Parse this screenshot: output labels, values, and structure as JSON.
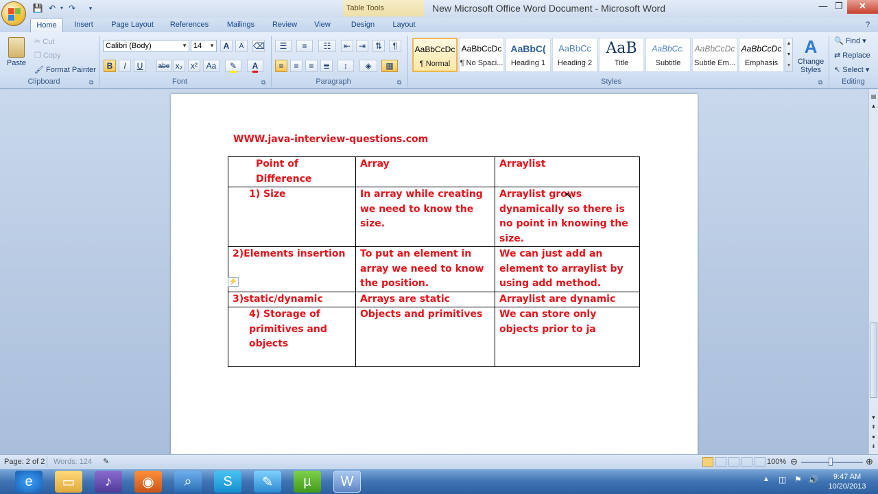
{
  "window": {
    "title": "New Microsoft Office Word Document - Microsoft Word",
    "context_tab_group": "Table Tools"
  },
  "quick_access": {
    "save": "save-icon",
    "undo": "undo-icon",
    "redo": "redo-icon",
    "customize": "▾"
  },
  "tabs": [
    "Home",
    "Insert",
    "Page Layout",
    "References",
    "Mailings",
    "Review",
    "View",
    "Design",
    "Layout"
  ],
  "clipboard": {
    "paste": "Paste",
    "cut": "Cut",
    "copy": "Copy",
    "format_painter": "Format Painter",
    "label": "Clipboard"
  },
  "font": {
    "name": "Calibri (Body)",
    "size": "14",
    "label": "Font",
    "bold": "B",
    "italic": "I",
    "underline": "U",
    "strike": "abe",
    "subscript": "x₂",
    "superscript": "x²",
    "change_case": "Aa",
    "grow": "A",
    "shrink": "A"
  },
  "paragraph": {
    "label": "Paragraph",
    "show_marks": "¶"
  },
  "styles": {
    "label": "Styles",
    "items": [
      {
        "preview": "AaBbCcDc",
        "name": "¶ Normal"
      },
      {
        "preview": "AaBbCcDc",
        "name": "¶ No Spaci..."
      },
      {
        "preview": "AaBbC(",
        "name": "Heading 1"
      },
      {
        "preview": "AaBbCc",
        "name": "Heading 2"
      },
      {
        "preview": "AaB",
        "name": "Title"
      },
      {
        "preview": "AaBbCc.",
        "name": "Subtitle"
      },
      {
        "preview": "AaBbCcDc",
        "name": "Subtle Em..."
      },
      {
        "preview": "AaBbCcDc",
        "name": "Emphasis"
      }
    ],
    "change_styles": "Change Styles"
  },
  "editing": {
    "label": "Editing",
    "find": "Find",
    "replace": "Replace",
    "select": "Select"
  },
  "document": {
    "url": "WWW.java-interview-questions.com",
    "table": {
      "headers": [
        "Point of Difference",
        "Array",
        "Arraylist"
      ],
      "rows": [
        [
          "1)  Size",
          "In array while creating we need to know the size.",
          "Arraylist grows dynamically so there is no point in knowing the size."
        ],
        [
          "2)Elements insertion",
          "To put an element in array we need to know the position.",
          "We can just add an element to arraylist by using add method."
        ],
        [
          "3)static/dynamic",
          "Arrays are static",
          "Arraylist are dynamic"
        ],
        [
          "4)  Storage of primitives and objects",
          "Objects and primitives",
          "We can store only objects prior to ja"
        ]
      ]
    }
  },
  "status": {
    "page": "Page: 2 of 2",
    "words": "Words: 124",
    "zoom": "100%"
  },
  "clock": {
    "time": "9:47 AM",
    "date": "10/20/2013"
  },
  "colors": {
    "doc_text": "#e4141b",
    "ribbon": "#d3e1f3"
  }
}
